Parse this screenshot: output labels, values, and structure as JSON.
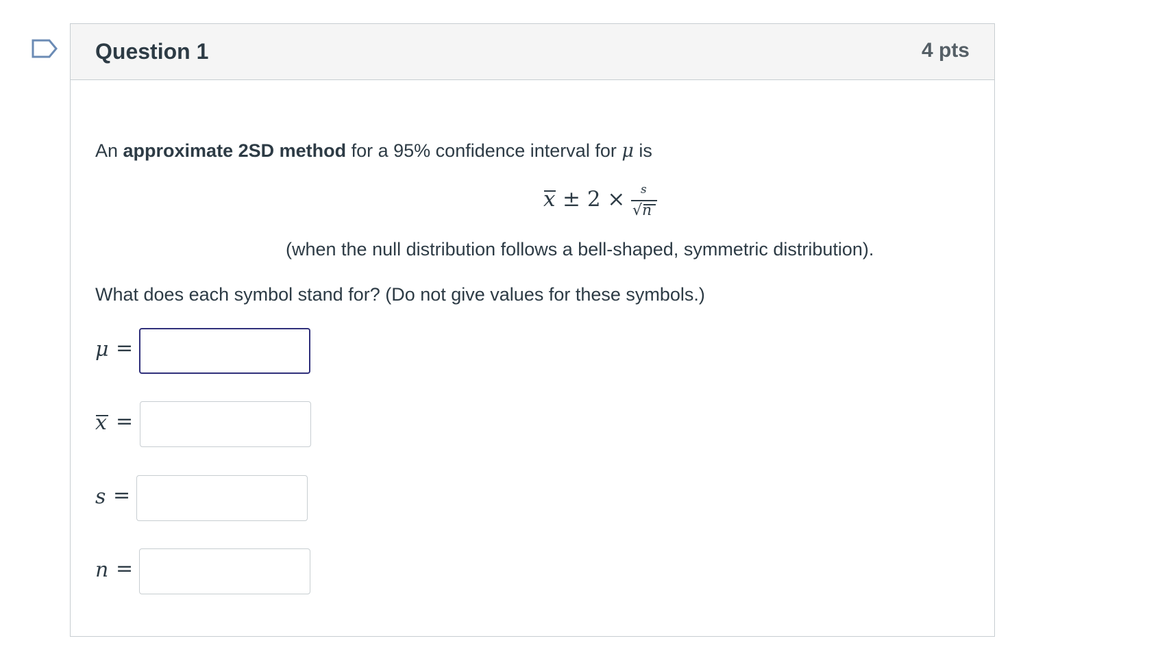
{
  "question": {
    "title": "Question 1",
    "points": "4 pts",
    "text_intro": "An ",
    "text_bold": "approximate 2SD method",
    "text_mid": " for a 95% confidence interval for ",
    "text_symbol": "μ",
    "text_end": " is",
    "formula": {
      "xbar": "x",
      "operator_part": "± 2 ×",
      "numerator": "s",
      "sqrt": "√",
      "denominator": "n"
    },
    "note": "(when the null distribution follows a bell-shaped, symmetric distribution).",
    "prompt": "What does each symbol stand for? (Do not give values for these symbols.)"
  },
  "answers": [
    {
      "symbol": "μ",
      "equals": "=",
      "value": "",
      "placeholder": ""
    },
    {
      "symbol": "x",
      "equals": "=",
      "value": "",
      "placeholder": ""
    },
    {
      "symbol": "s",
      "equals": "=",
      "value": "",
      "placeholder": ""
    },
    {
      "symbol": "n",
      "equals": "=",
      "value": "",
      "placeholder": ""
    }
  ],
  "icons": {
    "flag": "bookmark-flag-icon"
  },
  "colors": {
    "header_bg": "#f5f5f5",
    "border": "#c7cdd1",
    "text": "#2d3b45",
    "points": "#555f66",
    "focus_border": "#2f2f7a",
    "flag_stroke": "#6b8bb5"
  }
}
